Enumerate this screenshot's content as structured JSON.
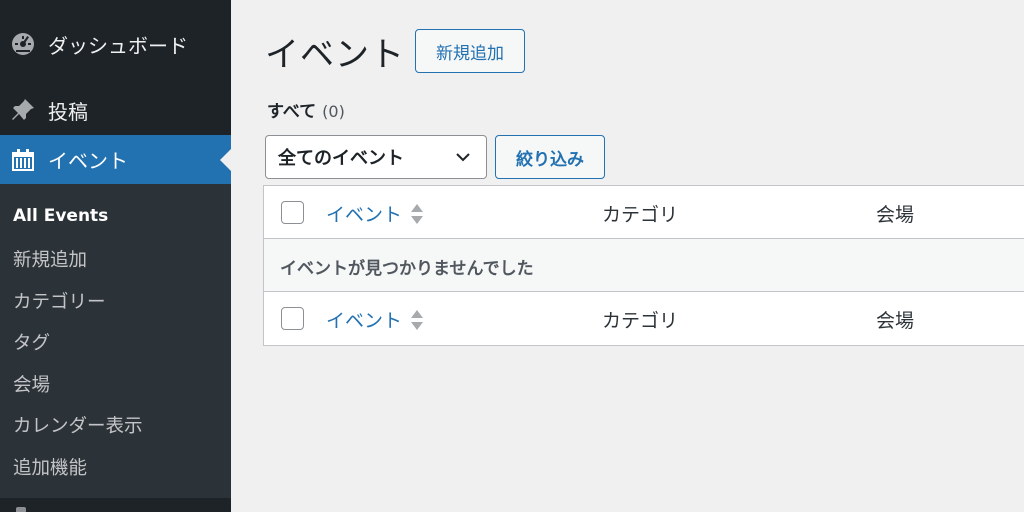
{
  "sidebar": {
    "dashboard": {
      "label": "ダッシュボード",
      "icon": "dashboard-gauge-icon"
    },
    "posts": {
      "label": "投稿",
      "icon": "pushpin-icon"
    },
    "events": {
      "label": "イベント",
      "icon": "calendar-icon"
    },
    "submenu": [
      {
        "label": "All Events",
        "current": true
      },
      {
        "label": "新規追加"
      },
      {
        "label": "カテゴリー"
      },
      {
        "label": "タグ"
      },
      {
        "label": "会場"
      },
      {
        "label": "カレンダー表示"
      },
      {
        "label": "追加機能"
      }
    ]
  },
  "main": {
    "title": "イベント",
    "add_new_label": "新規追加",
    "views": {
      "all_label": "すべて",
      "all_count": "(0)"
    },
    "filter": {
      "selected": "全てのイベント",
      "button_label": "絞り込み"
    },
    "table": {
      "columns": [
        "イベント",
        "カテゴリ",
        "会場"
      ],
      "empty_message": "イベントが見つかりませんでした"
    }
  },
  "colors": {
    "sidebar_bg": "#1d2327",
    "submenu_bg": "#2c3338",
    "accent": "#2271b1",
    "page_bg": "#f0f0f1"
  }
}
